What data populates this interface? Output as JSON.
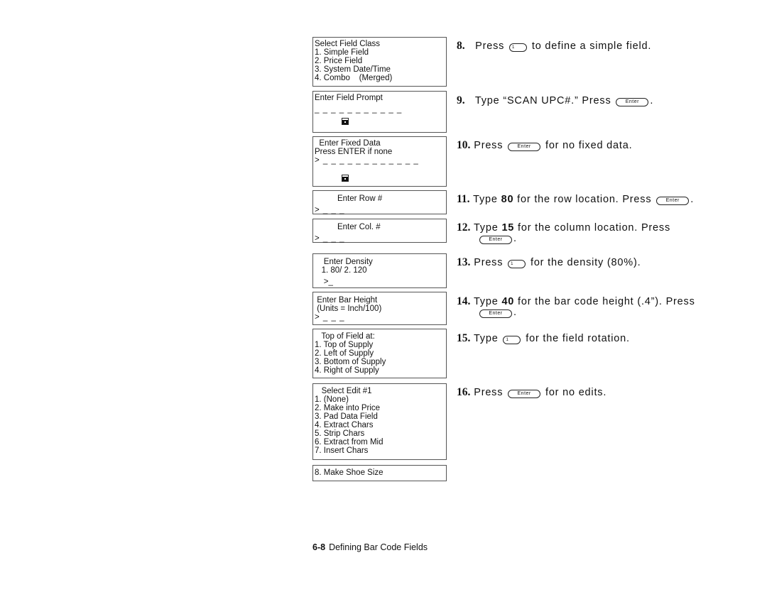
{
  "screens": [
    {
      "lines": [
        "Select Field Class",
        "1. Simple Field",
        "2. Price Field",
        "3. System Date/Time",
        "4. Combo    (Merged)"
      ]
    },
    {
      "lines": [
        "Enter Field Prompt",
        "",
        "_ _ _ _ _ _ _ _ _ _ _"
      ]
    },
    {
      "lines": [
        "  Enter Fixed Data",
        "Press ENTER if none",
        "> _ _ _ _ _ _ _ _ _ _ _ _"
      ]
    },
    {
      "lines": [
        "          Enter Row #",
        "> _ _ _"
      ]
    },
    {
      "lines": [
        "          Enter Col. #",
        "> _ _ _"
      ]
    },
    {
      "lines": [
        "    Enter Density",
        "   1. 80/ 2. 120",
        "    >_"
      ]
    },
    {
      "lines": [
        " Enter Bar Height",
        " (Units = Inch/100)",
        "> _ _ _"
      ]
    },
    {
      "lines": [
        "   Top of Field at:",
        "1. Top of Supply",
        "2. Left of Supply",
        "3. Bottom of Supply",
        "4. Right of Supply"
      ]
    },
    {
      "lines": [
        "   Select Edit #1",
        "1. (None)",
        "2. Make into Price",
        "3. Pad Data Field",
        "4. Extract Chars",
        "5. Strip Chars",
        "6. Extract from Mid",
        "7. Insert Chars"
      ]
    },
    {
      "lines": [
        "8. Make Shoe Size"
      ]
    }
  ],
  "keys": {
    "enter": "Enter",
    "one": "1"
  },
  "steps": [
    {
      "num": "8.",
      "a": "Press",
      "b": "to define a simple field."
    },
    {
      "num": "9.",
      "a": "Type “SCAN UPC#.”  Press",
      "b": "."
    },
    {
      "num": "10.",
      "a": "Press",
      "b": "for no fixed data."
    },
    {
      "num": "11.",
      "a": "Type",
      "bold": "80",
      "c": "for the row location.  Press",
      "b": "."
    },
    {
      "num": "12.",
      "a": "Type",
      "bold": "15",
      "c": "for the column location.  Press",
      "b": "."
    },
    {
      "num": "13.",
      "a": "Press",
      "b": "for the density (80%)."
    },
    {
      "num": "14.",
      "a": "Type",
      "bold": "40",
      "c": "for the bar code height (.4”).  Press",
      "b": "."
    },
    {
      "num": "15.",
      "a": "Type",
      "b": "for the field rotation."
    },
    {
      "num": "16.",
      "a": "Press",
      "b": "for no edits."
    }
  ],
  "footer": {
    "page": "6-8",
    "title": "Defining Bar Code Fields"
  }
}
